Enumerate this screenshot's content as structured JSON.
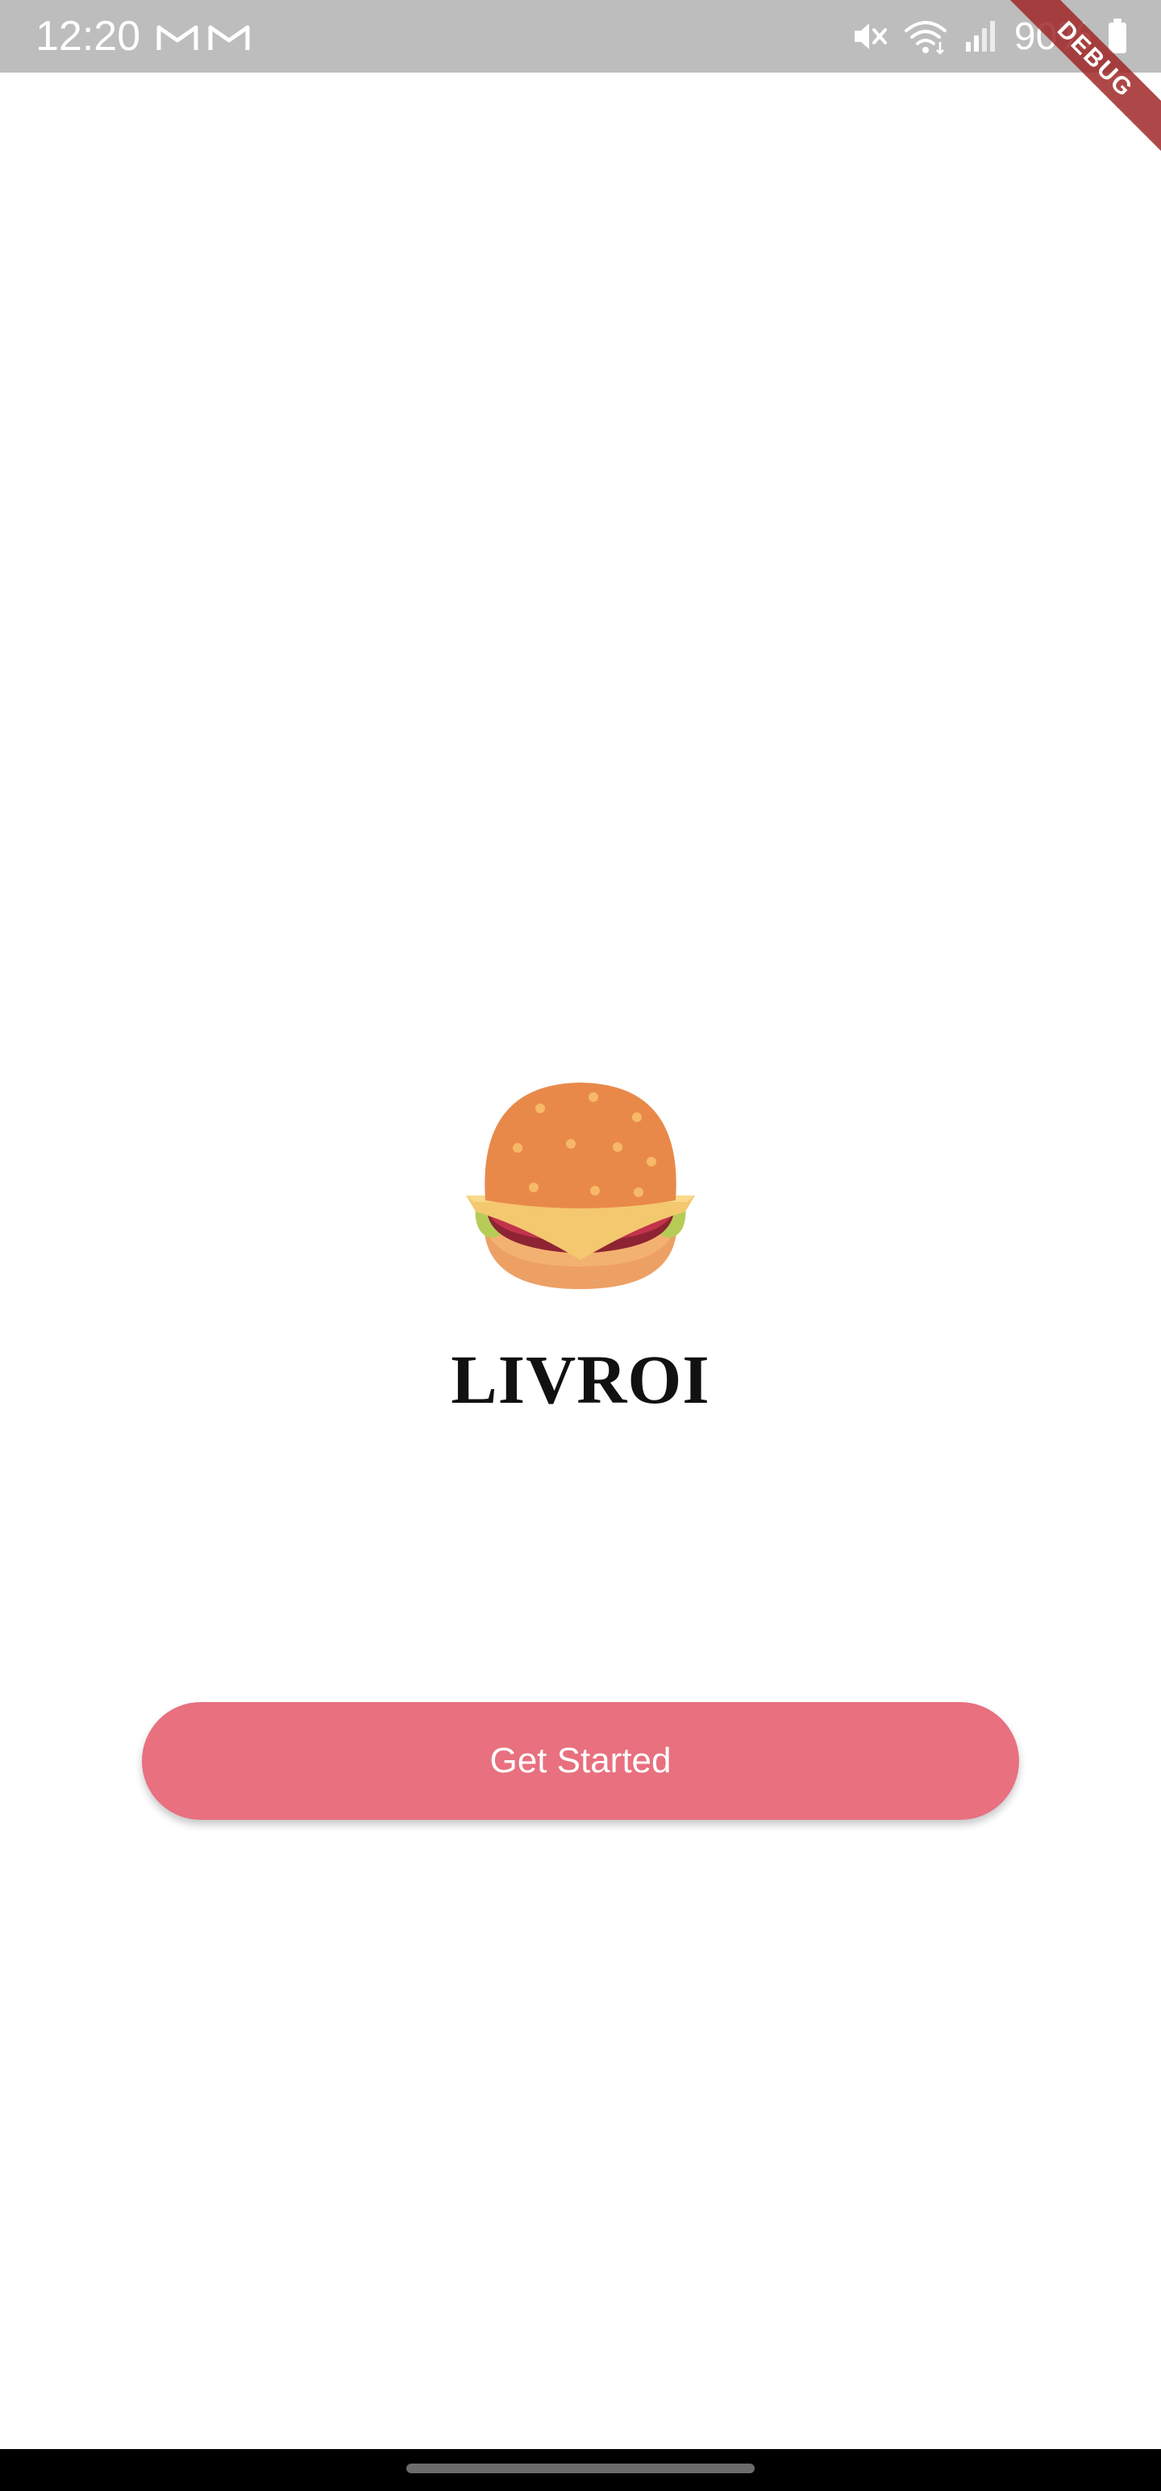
{
  "status_bar": {
    "time": "12:20",
    "notification_icons": [
      "gmail-icon",
      "gmail-icon"
    ],
    "system_icons": [
      "mute-icon",
      "wifi-icon",
      "signal-icon"
    ],
    "battery_percent": "90%"
  },
  "debug_banner": {
    "label": "DEBUG",
    "color": "#a02828"
  },
  "main": {
    "logo_icon": "burger-icon",
    "app_name": "LIVROI",
    "cta_label": "Get Started",
    "accent_color": "#e8707f"
  },
  "nav_bar": {
    "home_indicator": "home-indicator"
  }
}
